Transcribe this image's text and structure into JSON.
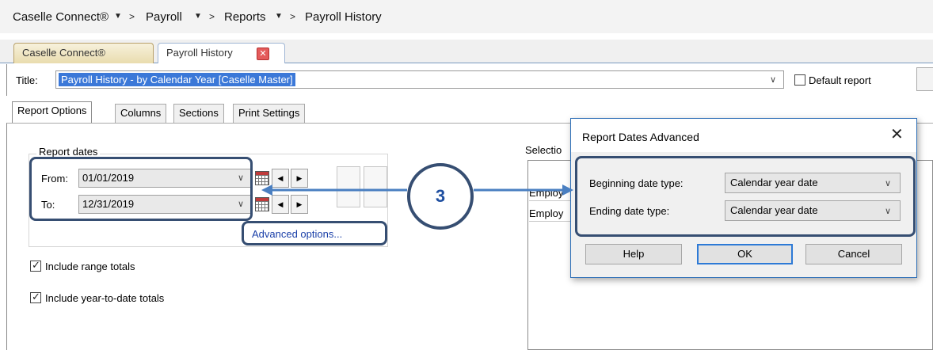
{
  "breadcrumb": {
    "items": [
      "Caselle Connect®",
      "Payroll",
      "Reports",
      "Payroll History"
    ],
    "dropdown_arrow": "▼",
    "separator": ">"
  },
  "doc_tabs": [
    {
      "label": "Caselle Connect®"
    },
    {
      "label": "Payroll History",
      "close_glyph": "✕"
    }
  ],
  "title_row": {
    "label": "Title:",
    "value": "Payroll History - by Calendar Year [Caselle Master]",
    "chevron": "∨",
    "default_report_label": "Default report",
    "default_report_checked": false
  },
  "report_tabs": [
    "Report Options",
    "Columns",
    "Sections",
    "Print Settings"
  ],
  "report_dates": {
    "group_title": "Report dates",
    "from_label": "From:",
    "from_value": "01/01/2019",
    "to_label": "To:",
    "to_value": "12/31/2019",
    "chevron": "∨",
    "prev_glyph": "◀",
    "next_glyph": "▶",
    "advanced_link": "Advanced options..."
  },
  "options": {
    "range_totals_label": "Include range totals",
    "range_totals_checked": true,
    "ytd_totals_label": "Include year-to-date totals",
    "ytd_totals_checked": true
  },
  "selection": {
    "label": "Selectio",
    "rows": [
      "Employ",
      "Employ"
    ]
  },
  "dialog": {
    "title": "Report Dates Advanced",
    "close_glyph": "✕",
    "beginning_label": "Beginning date type:",
    "beginning_value": "Calendar year date",
    "ending_label": "Ending date type:",
    "ending_value": "Calendar year date",
    "chevron": "∨",
    "help_label": "Help",
    "ok_label": "OK",
    "cancel_label": "Cancel"
  },
  "callout": {
    "number": "3"
  },
  "colors": {
    "highlight_border": "#364e72",
    "selection_blue": "#3b78d8",
    "link_blue": "#1a3fa8",
    "callout_text": "#1f4fa0"
  }
}
